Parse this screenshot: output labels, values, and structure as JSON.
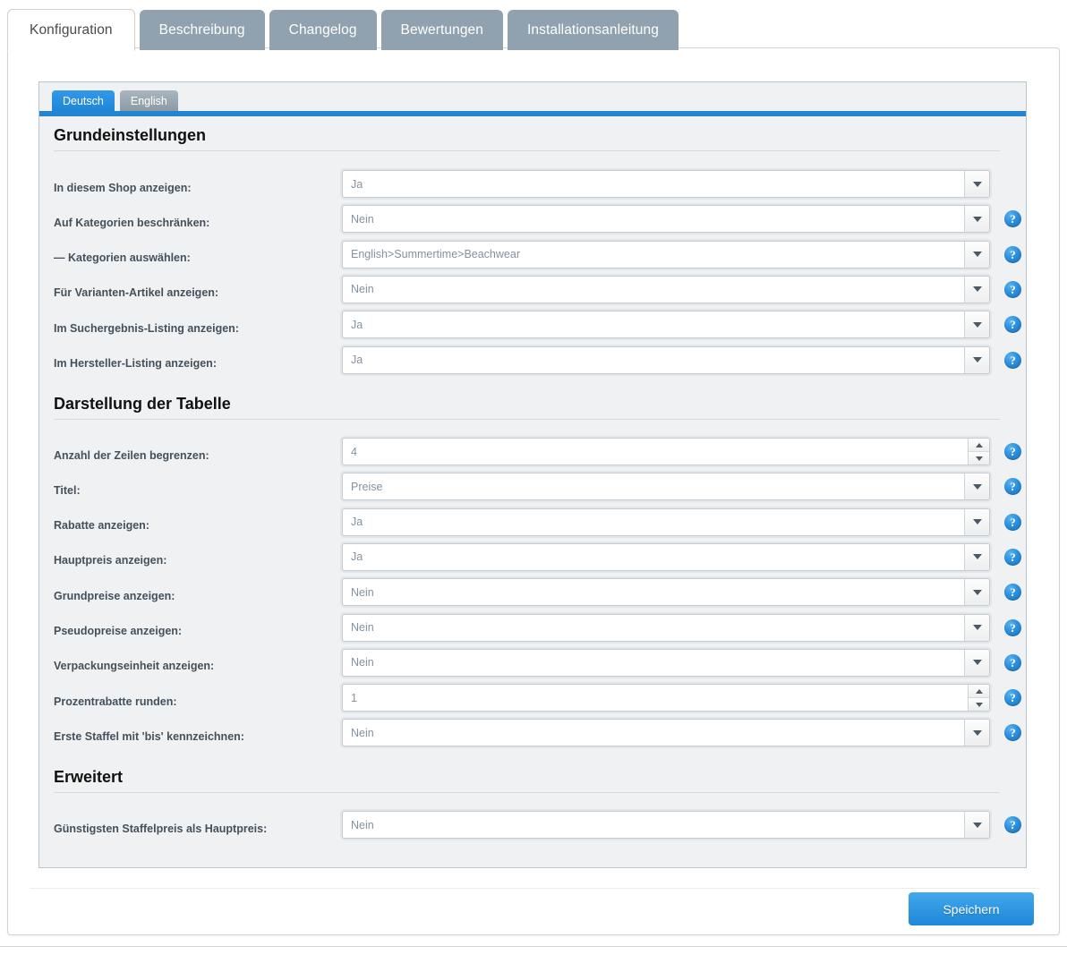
{
  "top_tabs": [
    {
      "label": "Konfiguration",
      "active": true
    },
    {
      "label": "Beschreibung",
      "active": false
    },
    {
      "label": "Changelog",
      "active": false
    },
    {
      "label": "Bewertungen",
      "active": false
    },
    {
      "label": "Installationsanleitung",
      "active": false
    }
  ],
  "language_tabs": [
    {
      "label": "Deutsch",
      "active": true
    },
    {
      "label": "English",
      "active": false
    }
  ],
  "help_icon_glyph": "?",
  "sections": [
    {
      "title": "Grundeinstellungen",
      "rows": [
        {
          "label": "In diesem Shop anzeigen:",
          "value": "Ja",
          "type": "select",
          "help": false
        },
        {
          "label": "Auf Kategorien beschränken:",
          "value": "Nein",
          "type": "select",
          "help": true
        },
        {
          "label": "— Kategorien auswählen:",
          "value": "English>Summertime>Beachwear",
          "type": "select",
          "help": true
        },
        {
          "label": "Für Varianten-Artikel anzeigen:",
          "value": "Nein",
          "type": "select",
          "help": true
        },
        {
          "label": "Im Suchergebnis-Listing anzeigen:",
          "value": "Ja",
          "type": "select",
          "help": true
        },
        {
          "label": "Im Hersteller-Listing anzeigen:",
          "value": "Ja",
          "type": "select",
          "help": true
        }
      ]
    },
    {
      "title": "Darstellung der Tabelle",
      "rows": [
        {
          "label": "Anzahl der Zeilen begrenzen:",
          "value": "4",
          "type": "number",
          "help": true
        },
        {
          "label": "Titel:",
          "value": "Preise",
          "type": "select",
          "help": true
        },
        {
          "label": "Rabatte anzeigen:",
          "value": "Ja",
          "type": "select",
          "help": true
        },
        {
          "label": "Hauptpreis anzeigen:",
          "value": "Ja",
          "type": "select",
          "help": true
        },
        {
          "label": "Grundpreise anzeigen:",
          "value": "Nein",
          "type": "select",
          "help": true
        },
        {
          "label": "Pseudopreise anzeigen:",
          "value": "Nein",
          "type": "select",
          "help": true
        },
        {
          "label": "Verpackungseinheit anzeigen:",
          "value": "Nein",
          "type": "select",
          "help": true
        },
        {
          "label": "Prozentrabatte runden:",
          "value": "1",
          "type": "number",
          "help": true
        },
        {
          "label": "Erste Staffel mit 'bis' kennzeichnen:",
          "value": "Nein",
          "type": "select",
          "help": true
        }
      ]
    },
    {
      "title": "Erweitert",
      "rows": [
        {
          "label": "Günstigsten Staffelpreis als Hauptpreis:",
          "value": "Nein",
          "type": "select",
          "help": true
        }
      ]
    }
  ],
  "footer": {
    "save_label": "Speichern"
  },
  "colors": {
    "accent_blue": "#2484d0",
    "tab_inactive": "#90a2af",
    "panel_bg": "#f0f1f2",
    "label_text": "#44515c",
    "value_text": "#8492a0"
  }
}
